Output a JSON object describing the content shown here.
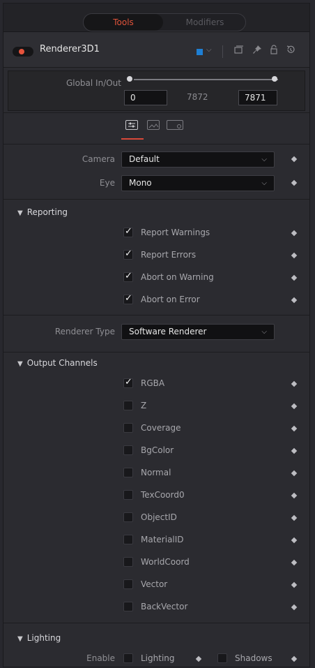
{
  "tabs": {
    "active": "Tools",
    "inactive": "Modifiers"
  },
  "tool": {
    "name": "Renderer3D1",
    "color_swatch": "#1e7fd4"
  },
  "header_icons": [
    "chevron-down-icon",
    "window-icon",
    "pin-icon",
    "lock-icon",
    "reset-icon"
  ],
  "global_inout": {
    "label": "Global In/Out",
    "start": "0",
    "mid": "7872",
    "end": "7871"
  },
  "inspector_tabs": [
    "controls-tab",
    "image-tab",
    "settings-tab"
  ],
  "camera": {
    "label": "Camera",
    "value": "Default"
  },
  "eye": {
    "label": "Eye",
    "value": "Mono"
  },
  "reporting": {
    "title": "Reporting",
    "items": [
      {
        "label": "Report Warnings",
        "checked": true
      },
      {
        "label": "Report Errors",
        "checked": true
      },
      {
        "label": "Abort on Warning",
        "checked": true
      },
      {
        "label": "Abort on Error",
        "checked": true
      }
    ]
  },
  "renderer_type": {
    "label": "Renderer Type",
    "value": "Software Renderer"
  },
  "output_channels": {
    "title": "Output Channels",
    "items": [
      {
        "label": "RGBA",
        "checked": true
      },
      {
        "label": "Z",
        "checked": false
      },
      {
        "label": "Coverage",
        "checked": false
      },
      {
        "label": "BgColor",
        "checked": false
      },
      {
        "label": "Normal",
        "checked": false
      },
      {
        "label": "TexCoord0",
        "checked": false
      },
      {
        "label": "ObjectID",
        "checked": false
      },
      {
        "label": "MaterialID",
        "checked": false
      },
      {
        "label": "WorldCoord",
        "checked": false
      },
      {
        "label": "Vector",
        "checked": false
      },
      {
        "label": "BackVector",
        "checked": false
      }
    ]
  },
  "lighting": {
    "title": "Lighting",
    "enable_label": "Enable",
    "lighting_label": "Lighting",
    "shadows_label": "Shadows"
  },
  "colors": {
    "accent": "#e0533a",
    "background": "#2b2b30"
  }
}
